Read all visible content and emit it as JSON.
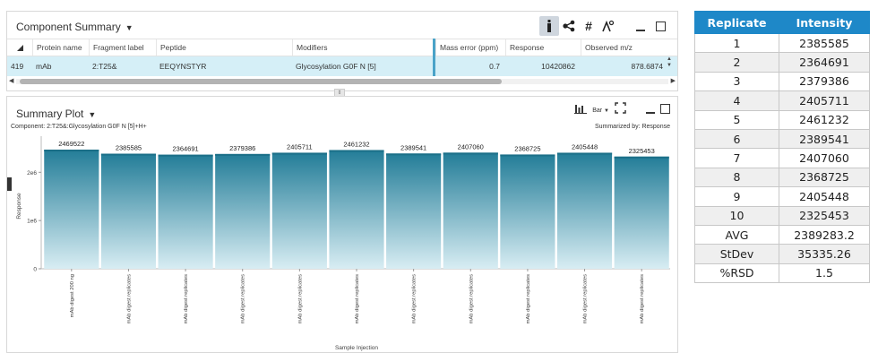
{
  "component_summary": {
    "title": "Component Summary",
    "toolbar": {
      "info_icon": "info-bar-icon",
      "network_icon": "network-icon",
      "hash_label": "#",
      "peak_icon": "peak-icon"
    },
    "columns": [
      "Protein name",
      "Fragment label",
      "Peptide",
      "Modifiers",
      "Mass error (ppm)",
      "Response",
      "Observed m/z"
    ],
    "row": {
      "index": "419",
      "protein": "mAb",
      "fragment": "2:T25&",
      "peptide": "EEQYNSTYR",
      "modifiers": "Glycosylation G0F N [5]",
      "mass_error": "0.7",
      "response": "10420862",
      "observed_mz": "878.6874"
    }
  },
  "summary_plot": {
    "title": "Summary Plot",
    "subtitle": "Component: 2:T25&:Glycosylation G0F N [5]+H+",
    "summarized_by": "Summarized by: Response",
    "bar_select": "Bar"
  },
  "chart_data": {
    "type": "bar",
    "categories": [
      "mAb digest 200 ng",
      "mAb digest replicates",
      "mAb digest replicates",
      "mAb digest replicates",
      "mAb digest replicates",
      "mAb digest replicates",
      "mAb digest replicates",
      "mAb digest replicates",
      "mAb digest replicates",
      "mAb digest replicates",
      "mAb digest replicates"
    ],
    "values": [
      2469522,
      2385585,
      2364691,
      2379386,
      2405711,
      2461232,
      2389541,
      2407060,
      2368725,
      2405448,
      2325453
    ],
    "xlabel": "Sample Injection",
    "ylabel": "Response",
    "ylim": [
      0,
      2600000
    ],
    "yticks": [
      0,
      1000000,
      2000000
    ],
    "ytick_labels": [
      "0",
      "1e6",
      "2e6"
    ],
    "bar_color_top": "#237d98",
    "bar_color_bottom": "#d8edf3"
  },
  "replicate_table": {
    "headers": [
      "Replicate",
      "Intensity"
    ],
    "rows": [
      [
        "1",
        "2385585"
      ],
      [
        "2",
        "2364691"
      ],
      [
        "3",
        "2379386"
      ],
      [
        "4",
        "2405711"
      ],
      [
        "5",
        "2461232"
      ],
      [
        "6",
        "2389541"
      ],
      [
        "7",
        "2407060"
      ],
      [
        "8",
        "2368725"
      ],
      [
        "9",
        "2405448"
      ],
      [
        "10",
        "2325453"
      ],
      [
        "AVG",
        "2389283.2"
      ],
      [
        "StDev",
        "35335.26"
      ],
      [
        "%RSD",
        "1.5"
      ]
    ],
    "header_color": "#1e88c8"
  }
}
